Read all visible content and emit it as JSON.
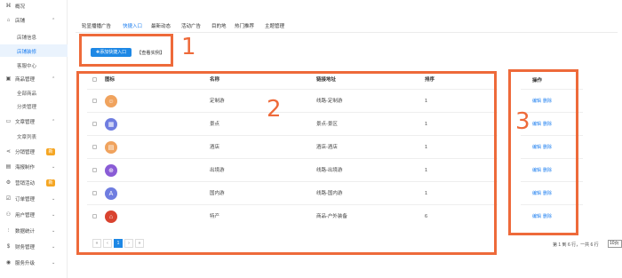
{
  "sidebar": {
    "overview": "概况",
    "store": "店铺",
    "store_info": "店铺信息",
    "store_decor": "店铺装修",
    "customer_center": "客服中心",
    "goods_mgmt": "商品管理",
    "all_goods": "全部商品",
    "category_mgmt": "分类管理",
    "article_mgmt": "文章管理",
    "article_list": "文章列表",
    "distribution_mgmt": "分销管理",
    "distribution_badge": "新",
    "poster_make": "海报制作",
    "marketing": "营销活动",
    "marketing_badge": "新",
    "order_mgmt": "订单管理",
    "user_mgmt": "用户管理",
    "data_stats": "数据统计",
    "finance_mgmt": "财务管理",
    "service_upgrade": "服务升级"
  },
  "tabs": [
    "轮显播播广告",
    "快捷入口",
    "最新动态",
    "活动广告",
    "目的地",
    "热门推荐",
    "主题管理"
  ],
  "toolbar": {
    "add_button": "✚添加快捷入口",
    "example_link": "【查看实例】"
  },
  "table": {
    "headers": {
      "icon": "图标",
      "name": "名称",
      "link": "链接地址",
      "sort": "排序"
    },
    "rows": [
      {
        "name": "定制游",
        "link": "线路-定制游",
        "sort": "1",
        "color": "#f0a35e",
        "glyph": "☺"
      },
      {
        "name": "景点",
        "link": "景点-景区",
        "sort": "1",
        "color": "#6f7de0",
        "glyph": "▦"
      },
      {
        "name": "酒店",
        "link": "酒店-酒店",
        "sort": "1",
        "color": "#f0a35e",
        "glyph": "▤"
      },
      {
        "name": "出境游",
        "link": "线路-出境游",
        "sort": "1",
        "color": "#8a5cd6",
        "glyph": "⊕"
      },
      {
        "name": "国内游",
        "link": "线路-国内游",
        "sort": "1",
        "color": "#6f7de0",
        "glyph": "A"
      },
      {
        "name": "特产",
        "link": "商品-户外装备",
        "sort": "6",
        "color": "#d9432f",
        "glyph": "⌂"
      }
    ]
  },
  "operations": {
    "header": "操作",
    "edit": "编辑",
    "delete": "删除"
  },
  "pagination": {
    "first": "«",
    "prev": "‹",
    "current": "1",
    "next": "›",
    "last": "»",
    "info": "第 1 到 6 行，一共 6 行",
    "page_size": "10页"
  },
  "annotations": {
    "one": "1",
    "two": "2",
    "three": "3",
    "color": "#ee6a3a"
  }
}
